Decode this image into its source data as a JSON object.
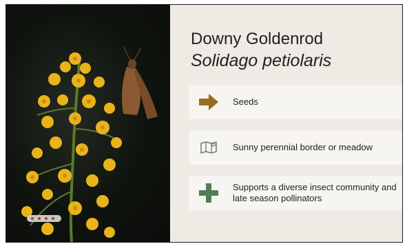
{
  "plant": {
    "common_name": "Downy Goldenrod",
    "scientific_name": "Solidago petiolaris"
  },
  "photo": {
    "icon": "goldenrod-flower-photo"
  },
  "features": [
    {
      "icon": "arrow-right-icon",
      "color": "#9a6d1e",
      "text": "Seeds"
    },
    {
      "icon": "map-icon",
      "color": "#6b6b6b",
      "text": "Sunny perennial border or meadow"
    },
    {
      "icon": "plus-icon",
      "color": "#4f7f57",
      "text": "Supports a diverse insect community and late season pollinators"
    }
  ]
}
